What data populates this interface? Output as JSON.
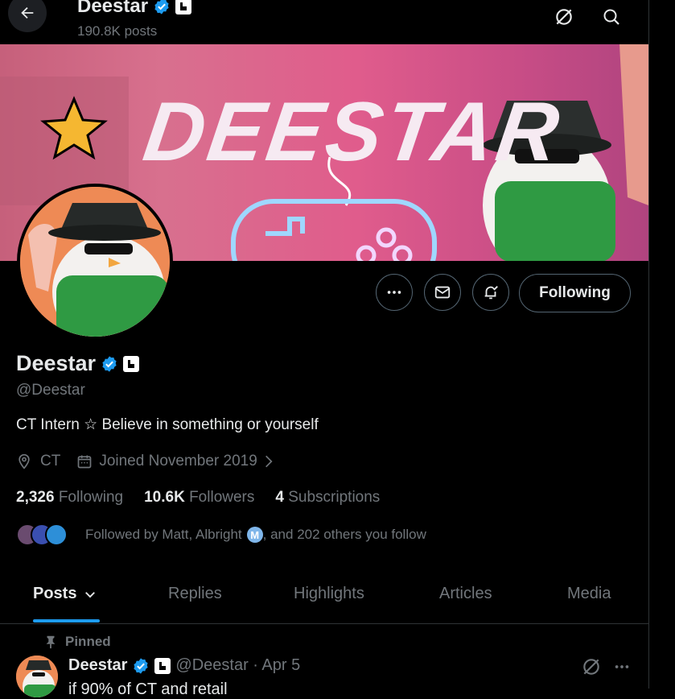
{
  "header": {
    "name": "Deestar",
    "posts": "190.8K posts"
  },
  "banner": {
    "title": "DEESTAR"
  },
  "profile": {
    "name": "Deestar",
    "handle": "@Deestar",
    "bio": "CT Intern ☆ Believe in something or yourself",
    "location": "CT",
    "joined": "Joined November 2019",
    "following_count": "2,326",
    "following_label": "Following",
    "followers_count": "10.6K",
    "followers_label": "Followers",
    "subs_count": "4",
    "subs_label": "Subscriptions",
    "followed_by_pre": "Followed by Matt, Albright",
    "followed_by_post": ", and 202 others you follow",
    "followed_badge_letter": "M"
  },
  "actions": {
    "following_button": "Following"
  },
  "tabs": [
    {
      "label": "Posts"
    },
    {
      "label": "Replies"
    },
    {
      "label": "Highlights"
    },
    {
      "label": "Articles"
    },
    {
      "label": "Media"
    }
  ],
  "post": {
    "pinned_label": "Pinned",
    "name": "Deestar",
    "handle_time": "@Deestar · Apr 5",
    "text": "if 90% of CT and retail"
  },
  "colors": {
    "accent": "#1d9bf0",
    "verified": "#1d9bf0",
    "background": "#000000"
  },
  "icons": [
    "back-arrow-icon",
    "grok-icon",
    "search-icon",
    "more-icon",
    "mail-icon",
    "bell-plus-icon",
    "location-icon",
    "calendar-icon",
    "chevron-right-icon",
    "pin-icon",
    "verified-icon",
    "affiliate-badge-icon",
    "chevron-down-icon"
  ]
}
